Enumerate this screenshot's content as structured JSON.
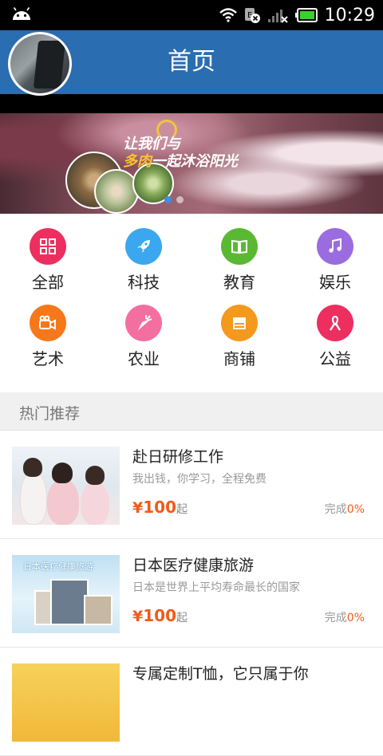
{
  "status_bar": {
    "time": "10:29",
    "icons": [
      "android-icon",
      "wifi-icon",
      "sim-off-icon",
      "signal-icon",
      "battery-icon"
    ]
  },
  "header": {
    "title": "首页",
    "color": "#2a6db0"
  },
  "banner": {
    "line1": "让我们与",
    "line2_highlight": "多肉",
    "line2_rest": "一起沐浴阳光",
    "slides": 2,
    "active_slide": 1
  },
  "categories": [
    {
      "label": "全部",
      "icon": "grid-icon",
      "color": "#ec2f5f"
    },
    {
      "label": "科技",
      "icon": "rocket-icon",
      "color": "#3aa7ee"
    },
    {
      "label": "教育",
      "icon": "book-icon",
      "color": "#5bb832"
    },
    {
      "label": "娱乐",
      "icon": "music-icon",
      "color": "#9b6ce0"
    },
    {
      "label": "艺术",
      "icon": "camera-icon",
      "color": "#f7781b"
    },
    {
      "label": "农业",
      "icon": "carrot-icon",
      "color": "#f36f9f"
    },
    {
      "label": "商铺",
      "icon": "store-icon",
      "color": "#f4981e"
    },
    {
      "label": "公益",
      "icon": "ribbon-icon",
      "color": "#ec2f5f"
    }
  ],
  "section": {
    "title": "热门推荐"
  },
  "items": [
    {
      "title": "赴日研修工作",
      "subtitle": "我出钱，你学习，全程免费",
      "currency": "¥",
      "price": "100",
      "price_suffix": "起",
      "done_label": "完成",
      "done_pct": "0%"
    },
    {
      "title": "日本医疗健康旅游",
      "subtitle": "日本是世界上平均寿命最长的国家",
      "currency": "¥",
      "price": "100",
      "price_suffix": "起",
      "done_label": "完成",
      "done_pct": "0%",
      "thumb_caption": "日本医疗健康旅游"
    },
    {
      "title": "专属定制T恤，它只属于你"
    }
  ]
}
